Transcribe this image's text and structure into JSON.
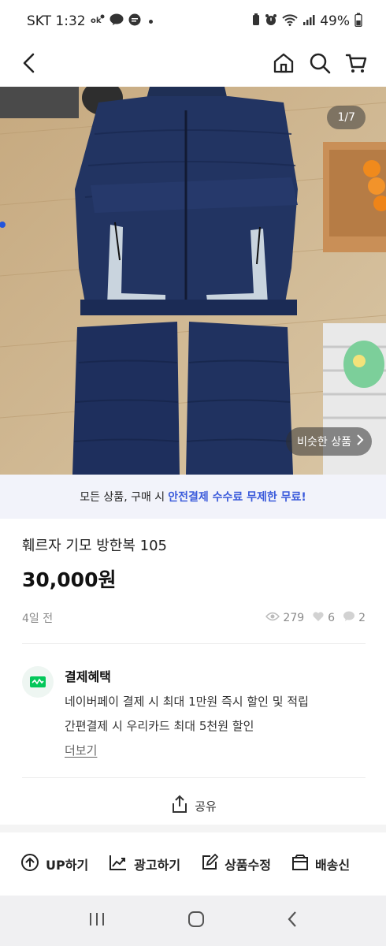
{
  "status_bar": {
    "carrier_time": "SKT 1:32",
    "battery": "49%",
    "icons": [
      "kakao-ok-icon",
      "talk-icon",
      "message-icon",
      "alarm-icon",
      "wifi-icon",
      "signal-icon",
      "battery-icon"
    ]
  },
  "nav": {
    "icons": [
      "back-icon",
      "home-icon",
      "search-icon",
      "cart-icon"
    ]
  },
  "gallery": {
    "counter": "1/7",
    "similar_label": "비슷한 상품",
    "current": 1,
    "total": 7
  },
  "promo": {
    "text": "모든 상품, 구매 시",
    "highlight": "안전결제 수수료 무제한 무료!",
    "highlight_color": "#3b5bdb"
  },
  "product": {
    "title": "훼르자 기모 방한복 105",
    "price": "30,000원",
    "posted": "4일 전",
    "views": "279",
    "likes": "6",
    "chats": "2"
  },
  "benefit": {
    "title": "결제혜택",
    "lines": [
      "네이버페이 결제 시 최대 1만원 즉시 할인 및 적립",
      "간편결제 시 우리카드 최대 5천원 할인"
    ],
    "more": "더보기",
    "logo_color": "#03c75a"
  },
  "share": {
    "label": "공유"
  },
  "actions": [
    {
      "label": "UP하기",
      "icon": "up-circle-icon"
    },
    {
      "label": "광고하기",
      "icon": "chart-icon"
    },
    {
      "label": "상품수정",
      "icon": "edit-icon"
    },
    {
      "label": "배송신",
      "icon": "box-icon"
    }
  ]
}
